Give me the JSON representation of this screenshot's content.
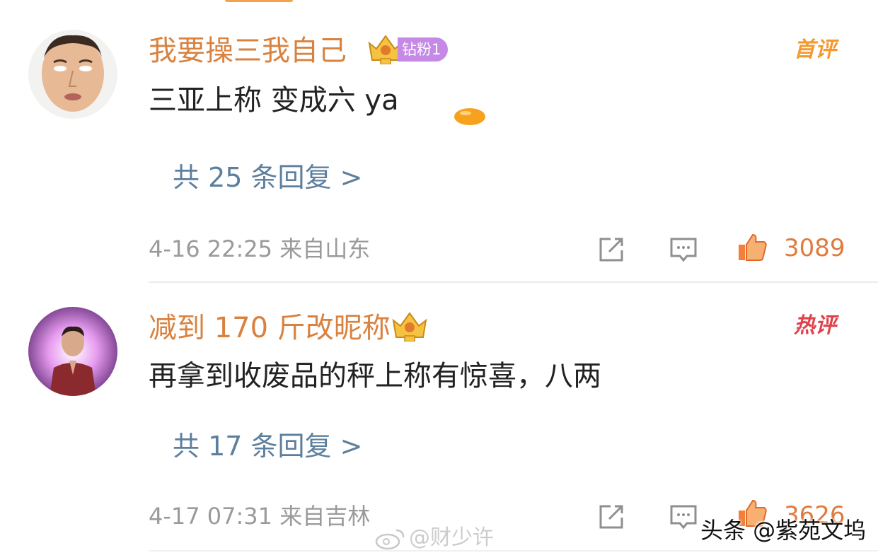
{
  "comments": [
    {
      "nickname": "我要操三我自己",
      "badge": "钻粉1",
      "tag": "首评",
      "text": "三亚上称 变成六 ya",
      "replies": "共 25 条回复 >",
      "meta": "4-16 22:25 来自山东",
      "likes": "3089"
    },
    {
      "nickname": "减到 170 斤改昵称",
      "tag": "热评",
      "text": "再拿到收废品的秤上称有惊喜，八两",
      "replies": "共 17 条回复 >",
      "meta": "4-17 07:31 来自吉林",
      "likes": "3626"
    }
  ],
  "watermarks": {
    "weibo": "@财少许",
    "toutiao": "头条 @紫苑文坞"
  },
  "colors": {
    "nickname": "#d9823f",
    "reply_link": "#5d7f9e",
    "first_tag": "#f39a2f",
    "hot_tag": "#e0414a",
    "like": "#e07a3d",
    "fan_badge": "#c48ae6"
  },
  "icons": [
    "crown-icon",
    "share-icon",
    "comment-icon",
    "like-icon",
    "weibo-logo-icon"
  ]
}
